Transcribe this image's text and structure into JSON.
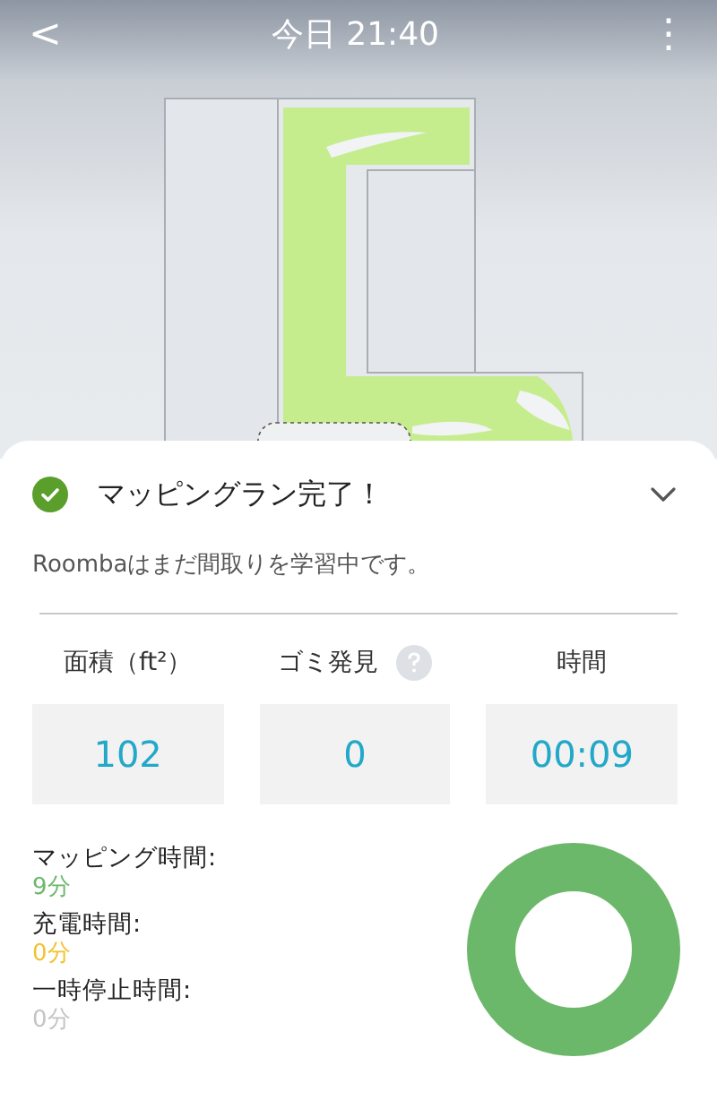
{
  "header": {
    "back": "<",
    "title": "今日 21:40",
    "menu": "⋮"
  },
  "summary": {
    "completed": true,
    "title": "マッピングラン完了！",
    "expanded": true,
    "message": "Roombaはまだ間取りを学習中です。"
  },
  "metrics": [
    {
      "label": "面積（ft²）",
      "value": "102",
      "help": false
    },
    {
      "label": "ゴミ発見",
      "value": "0",
      "help": true
    },
    {
      "label": "時間",
      "value": "00:09",
      "help": false
    }
  ],
  "durations": [
    {
      "label": "マッピング時間:",
      "value": "9分",
      "color": "#6cb86a"
    },
    {
      "label": "充電時間:",
      "value": "0分",
      "color": "#f2c230"
    },
    {
      "label": "一時停止時間:",
      "value": "0分",
      "color": "#c4c4c4"
    }
  ]
}
